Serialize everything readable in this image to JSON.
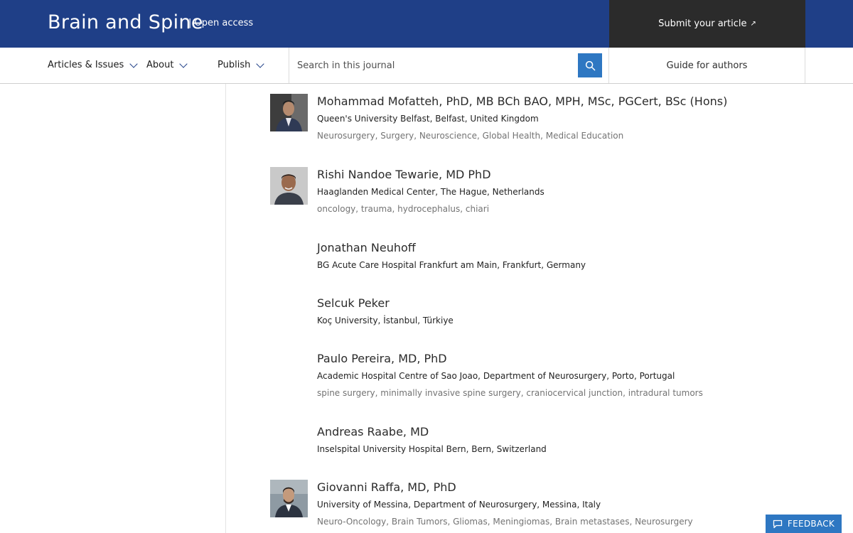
{
  "header": {
    "journal_title": "Brain and Spine",
    "access_label": "| Open access",
    "submit_label": "Submit your article",
    "submit_arrow": "↗"
  },
  "nav": {
    "items": [
      {
        "label": "Articles & Issues"
      },
      {
        "label": "About"
      },
      {
        "label": "Publish"
      }
    ],
    "search_placeholder": "Search in this journal",
    "guide_label": "Guide for authors"
  },
  "editors": [
    {
      "name": "Mohammad Mofatteh, PhD, MB BCh BAO, MPH, MSc, PGCert, BSc (Hons)",
      "affiliation": "Queen's University Belfast, Belfast, United Kingdom",
      "topics": "Neurosurgery, Surgery, Neuroscience, Global Health, Medical Education",
      "has_photo": true
    },
    {
      "name": "Rishi Nandoe Tewarie, MD PhD",
      "affiliation": "Haaglanden Medical Center, The Hague, Netherlands",
      "topics": "oncology, trauma, hydrocephalus, chiari",
      "has_photo": true
    },
    {
      "name": "Jonathan Neuhoff",
      "affiliation": "BG Acute Care Hospital Frankfurt am Main, Frankfurt, Germany",
      "topics": "",
      "has_photo": false
    },
    {
      "name": "Selcuk Peker",
      "affiliation": "Koç University, İstanbul, Türkiye",
      "topics": "",
      "has_photo": false
    },
    {
      "name": "Paulo Pereira, MD, PhD",
      "affiliation": "Academic Hospital Centre of Sao Joao, Department of Neurosurgery, Porto, Portugal",
      "topics": "spine surgery, minimally invasive spine surgery, craniocervical junction, intradural tumors",
      "has_photo": false
    },
    {
      "name": "Andreas Raabe, MD",
      "affiliation": "Inselspital University Hospital Bern, Bern, Switzerland",
      "topics": "",
      "has_photo": false
    },
    {
      "name": "Giovanni Raffa, MD, PhD",
      "affiliation": "University of Messina, Department of Neurosurgery, Messina, Italy",
      "topics": "Neuro-Oncology, Brain Tumors, Gliomas, Meningiomas, Brain metastases, Neurosurgery",
      "has_photo": true
    }
  ],
  "feedback_label": "FEEDBACK",
  "colors": {
    "header_blue": "#1f3f87",
    "submit_dark": "#2b2b2b",
    "accent_blue": "#2e77c2",
    "muted_text": "#737373"
  },
  "icons": [
    "search-icon",
    "chevron-down-icon",
    "external-link-icon",
    "chat-bubble-icon"
  ]
}
